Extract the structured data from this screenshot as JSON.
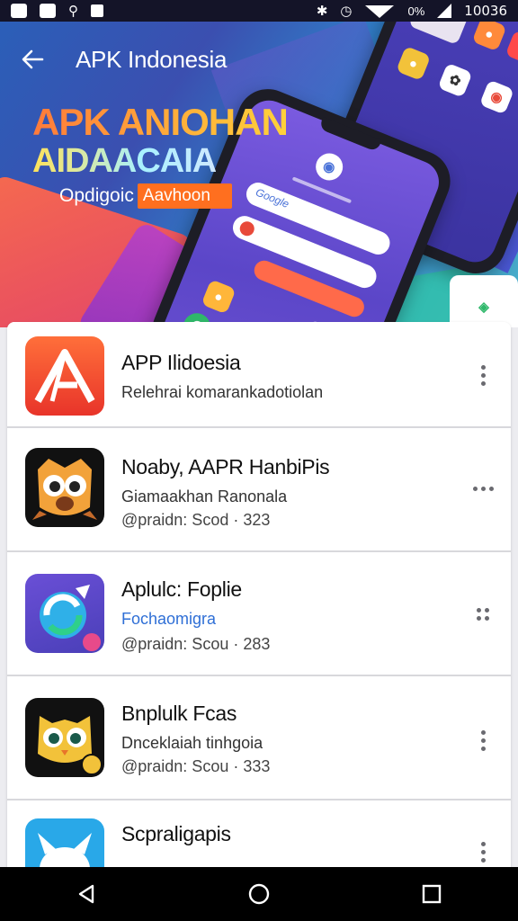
{
  "status_bar": {
    "battery_pct": "0%",
    "time": "10036",
    "icons": [
      "app-icon-1",
      "app-icon-2",
      "usb-icon",
      "lock-icon",
      "bluetooth-icon",
      "alarm-icon",
      "wifi-icon",
      "signal-icon"
    ]
  },
  "header": {
    "title": "APK Indonesia",
    "back_icon": "arrow-left-icon"
  },
  "banner": {
    "line1": "APK ANIOHAN",
    "line2": "AIDAACAIA",
    "sub_left": "Opdigoic",
    "sub_right": "Aavhoon",
    "phone_search_text": "Google"
  },
  "apps": [
    {
      "name": "APP Ilidoesia",
      "desc": "Relehrai komarankadotiolan",
      "meta": "",
      "icon": "red-a-logo-icon",
      "menu_icon": "more-vert-icon"
    },
    {
      "name": "Noaby, AAPR HanbiPis",
      "desc": "Giamaakhan Ranonala",
      "meta": "@praidn: Scod · 323",
      "icon": "owl-mascot-icon",
      "menu_icon": "more-horiz-icon"
    },
    {
      "name": "Aplulc: Foplie",
      "desc": "Fochaomigra",
      "meta": "@praidn: Scou · 283",
      "icon": "blue-swirl-icon",
      "menu_icon": "more-grid-icon"
    },
    {
      "name": "Bnplulk Fcas",
      "desc": "Dnceklaiah tinhgoia",
      "meta": "@praidn: Scou · 333",
      "icon": "yellow-owl-icon",
      "menu_icon": "more-vert-icon"
    },
    {
      "name": "Scpraligapis",
      "desc": "",
      "meta": "",
      "icon": "white-dog-icon",
      "menu_icon": "more-vert-icon"
    }
  ],
  "nav": {
    "back": "nav-back-icon",
    "home": "nav-home-icon",
    "recents": "nav-recents-icon"
  },
  "colors": {
    "status_bar": "#141428",
    "accent_orange": "#ff6f1f",
    "link_blue": "#2f6fd6",
    "nav_bar": "#000000"
  }
}
